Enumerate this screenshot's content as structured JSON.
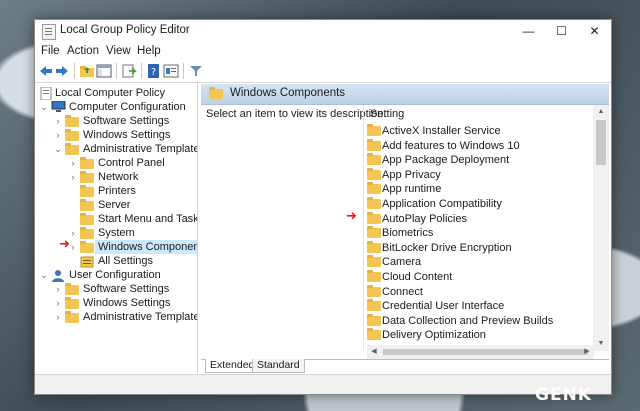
{
  "window": {
    "title": "Local Group Policy Editor"
  },
  "menu": [
    "File",
    "Action",
    "View",
    "Help"
  ],
  "tree": {
    "root": "Local Computer Policy",
    "computer_config": "Computer Configuration",
    "cc_software": "Software Settings",
    "cc_windows": "Windows Settings",
    "cc_admin": "Administrative Templates",
    "control_panel": "Control Panel",
    "network": "Network",
    "printers": "Printers",
    "server": "Server",
    "start_menu": "Start Menu and Taskbar",
    "system": "System",
    "windows_components": "Windows Components",
    "all_settings": "All Settings",
    "user_config": "User Configuration",
    "uc_software": "Software Settings",
    "uc_windows": "Windows Settings",
    "uc_admin": "Administrative Templates"
  },
  "right_pane": {
    "header": "Windows Components",
    "description": "Select an item to view its description.",
    "column_setting": "Setting",
    "items": [
      "ActiveX Installer Service",
      "Add features to Windows 10",
      "App Package Deployment",
      "App Privacy",
      "App runtime",
      "Application Compatibility",
      "AutoPlay Policies",
      "Biometrics",
      "BitLocker Drive Encryption",
      "Camera",
      "Cloud Content",
      "Connect",
      "Credential User Interface",
      "Data Collection and Preview Builds",
      "Delivery Optimization"
    ]
  },
  "tabs": {
    "extended": "Extended",
    "standard": "Standard"
  },
  "watermark": "GENK",
  "colors": {
    "header_blue": "#c9dbee",
    "selection": "#cce8ff",
    "folder": "#f3c654",
    "arrow_red": "#e21b1b"
  }
}
